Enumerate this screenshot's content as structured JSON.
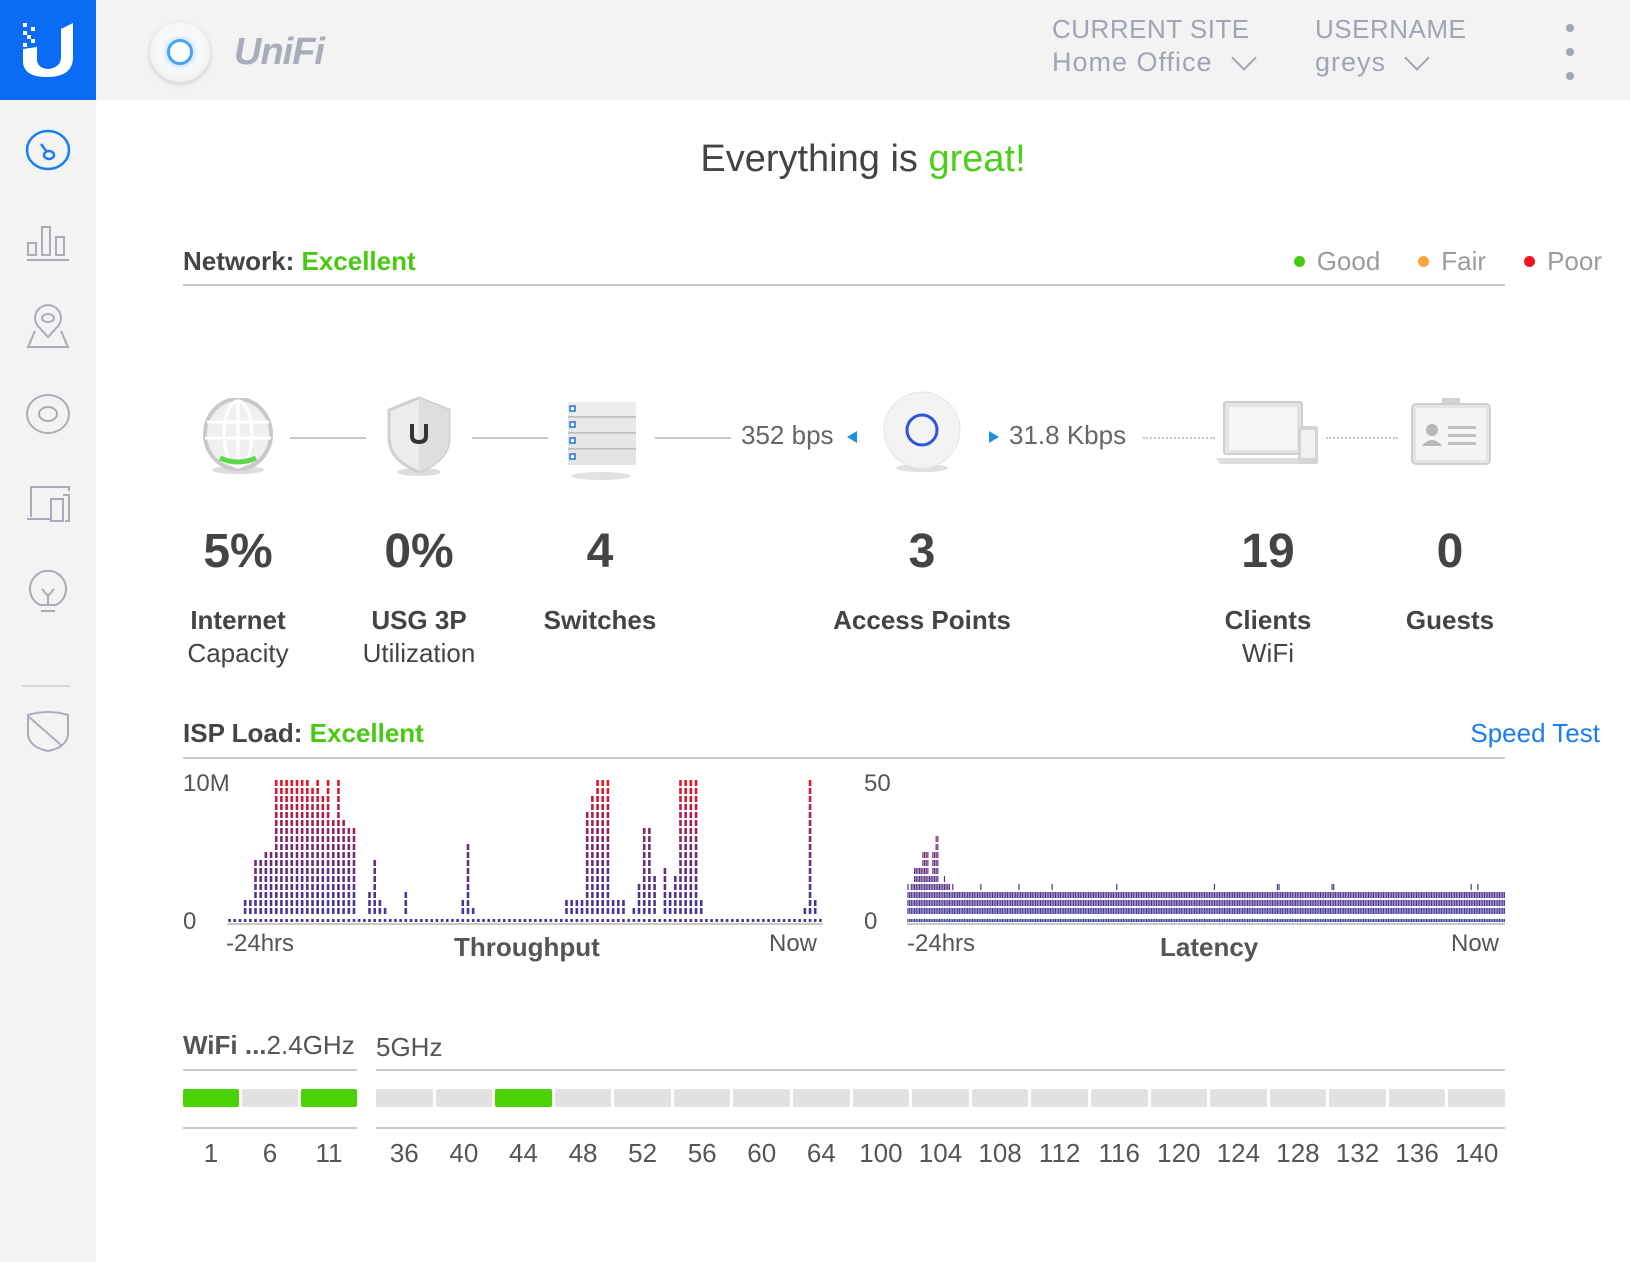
{
  "header": {
    "app_name": "UniFi",
    "site_caption": "CURRENT SITE",
    "site_value": "Home Office",
    "user_caption": "USERNAME",
    "user_value": "greys"
  },
  "sidebar": {
    "items": [
      {
        "name": "dashboard",
        "icon": "dashboard-gauge-icon",
        "active": true
      },
      {
        "name": "statistics",
        "icon": "bar-chart-icon",
        "active": false
      },
      {
        "name": "map",
        "icon": "map-pin-icon",
        "active": false
      },
      {
        "name": "devices",
        "icon": "access-point-icon",
        "active": false
      },
      {
        "name": "clients",
        "icon": "client-devices-icon",
        "active": false
      },
      {
        "name": "insights",
        "icon": "lightbulb-icon",
        "active": false
      },
      {
        "name": "alerts",
        "icon": "shield-slash-icon",
        "active": false
      }
    ]
  },
  "headline": {
    "prefix": "Everything is ",
    "status": "great!"
  },
  "network": {
    "label": "Network:",
    "status": "Excellent",
    "legend": [
      {
        "label": "Good",
        "color": "#44cc11"
      },
      {
        "label": "Fair",
        "color": "#f9a537"
      },
      {
        "label": "Poor",
        "color": "#f0141e"
      }
    ],
    "uplink_rate": "352 bps",
    "downlink_rate": "31.8 Kbps",
    "stats": [
      {
        "value": "5%",
        "line1": "Internet",
        "line2": "Capacity"
      },
      {
        "value": "0%",
        "line1": "USG 3P",
        "line2": "Utilization"
      },
      {
        "value": "4",
        "line1": "Switches",
        "line2": ""
      },
      {
        "value": "3",
        "line1": "Access Points",
        "line2": ""
      },
      {
        "value": "19",
        "line1": "Clients",
        "line2": "WiFi"
      },
      {
        "value": "0",
        "line1": "Guests",
        "line2": ""
      }
    ]
  },
  "isp": {
    "label": "ISP Load:",
    "status": "Excellent",
    "speed_test_label": "Speed Test"
  },
  "chart_data": [
    {
      "type": "bar",
      "title": "Throughput",
      "ylabel": "",
      "ymax_label": "10M",
      "ymin_label": "0",
      "x_start_label": "-24hrs",
      "x_end_label": "Now",
      "ylim": [
        0,
        10
      ],
      "units": "Mbps",
      "values": [
        0.3,
        0.8,
        0.8,
        1.6,
        1.6,
        4.2,
        4.2,
        5.1,
        5.1,
        10,
        10,
        10,
        10,
        10,
        10,
        10,
        9.4,
        10,
        8.9,
        10,
        7.3,
        10,
        7.3,
        6.9,
        6.9,
        0.6,
        0.6,
        2.3,
        4.2,
        1.8,
        1.3,
        0.7,
        0.6,
        0.6,
        2.1,
        0.4,
        0.3,
        0.3,
        0.2,
        0.8,
        0.3,
        0.1,
        0.3,
        0.1,
        0,
        1.8,
        5.3,
        0.9,
        0.2,
        0,
        0,
        0.2,
        0,
        0.2,
        0.1,
        0,
        0,
        0.1,
        0,
        0,
        0,
        0,
        0.2,
        0.6,
        0.8,
        1.4,
        1.4,
        1.4,
        1.6,
        8,
        8.7,
        10,
        10,
        10,
        1.6,
        1.4,
        1.4,
        0.8,
        1.2,
        2.9,
        6.5,
        6.5,
        3.1,
        0.8,
        3.9,
        2.3,
        3.5,
        10,
        10,
        10,
        10,
        1.6,
        0.6,
        0.2,
        0.1,
        0,
        0,
        0,
        0,
        0,
        0,
        0,
        0,
        0.1,
        0,
        0,
        0,
        0,
        0,
        0.2,
        0.3,
        1,
        10,
        1.4,
        0.8
      ]
    },
    {
      "type": "bar",
      "title": "Latency",
      "ylabel": "",
      "ymax_label": "50",
      "ymin_label": "0",
      "x_start_label": "-24hrs",
      "x_end_label": "Now",
      "ylim": [
        0,
        50
      ],
      "units": "ms",
      "values": [
        14,
        12,
        15,
        15,
        20,
        20,
        20,
        20,
        20,
        24,
        24,
        24,
        24,
        16,
        16,
        25,
        25,
        30,
        30,
        14,
        13,
        14,
        16,
        13,
        14,
        14,
        12,
        14,
        12,
        12,
        12,
        12,
        12,
        12,
        12,
        12,
        12,
        12,
        12,
        12,
        12,
        12,
        12,
        12,
        13,
        12,
        12,
        12,
        12,
        12,
        12,
        12,
        12,
        12,
        12,
        12,
        12,
        12,
        12,
        12,
        12,
        12,
        12,
        12,
        12,
        12,
        12,
        13,
        12,
        12,
        12,
        12,
        12,
        12,
        12,
        12,
        12,
        12,
        12,
        12,
        12,
        12,
        12,
        12,
        12,
        12,
        12,
        13,
        12,
        12,
        12,
        12,
        12,
        12,
        12,
        12,
        12,
        12,
        12,
        12,
        12,
        12,
        12,
        12,
        12,
        12,
        12,
        12,
        12,
        12,
        12,
        12,
        12,
        12,
        12,
        12,
        12,
        12,
        12,
        12,
        12,
        12,
        12,
        12,
        12,
        12,
        13,
        12,
        12,
        12,
        12,
        12,
        12,
        12,
        12,
        12,
        12,
        12,
        12,
        12,
        12,
        12,
        12,
        12,
        12,
        12,
        12,
        12,
        12,
        12,
        12,
        12,
        12,
        12,
        12,
        12,
        12,
        12,
        12,
        12,
        12,
        12,
        12,
        12,
        12,
        12,
        12,
        12,
        12,
        12,
        12,
        12,
        12,
        12,
        12,
        12,
        12,
        12,
        12,
        12,
        12,
        12,
        12,
        12,
        12,
        13,
        12,
        12,
        12,
        12,
        12,
        12,
        12,
        12,
        12,
        12,
        12,
        12,
        12,
        12,
        12,
        12,
        12,
        12,
        12,
        12,
        12,
        12,
        12,
        12,
        12,
        12,
        12,
        12,
        12,
        12,
        12,
        12,
        12,
        12,
        12,
        12,
        12,
        13,
        13,
        12,
        12,
        12,
        12,
        12,
        12,
        12,
        12,
        12,
        12,
        12,
        12,
        12,
        12,
        12,
        12,
        12,
        12,
        12,
        12,
        12,
        12,
        12,
        12,
        12,
        12,
        12,
        12,
        12,
        12,
        12,
        15,
        15,
        12,
        12,
        12,
        12,
        12,
        12,
        12,
        12,
        12,
        12,
        12,
        12,
        12,
        12,
        12,
        12,
        12,
        12,
        12,
        12,
        12,
        12,
        12,
        12,
        12,
        12,
        12,
        12,
        12,
        12,
        12,
        12,
        12,
        12,
        12,
        12,
        12,
        12,
        12,
        12,
        12,
        12,
        12,
        12,
        12,
        12,
        12,
        12,
        12,
        12,
        12,
        12,
        12,
        12,
        12,
        12,
        12,
        12,
        12,
        12,
        12,
        12,
        12,
        12,
        12,
        12,
        12,
        12,
        12,
        12,
        12,
        12,
        12,
        12,
        12,
        12,
        12,
        12,
        12,
        12,
        12,
        12,
        13,
        12,
        12,
        12,
        13,
        12,
        12,
        12,
        12,
        12,
        12,
        12,
        12,
        12,
        12,
        12,
        12,
        12,
        12,
        12,
        12
      ]
    }
  ],
  "wifi": {
    "label": "WiFi ...",
    "band_24_label": "2.4GHz",
    "band_5_label": "5GHz",
    "channels_24": [
      {
        "ch": "1",
        "active": true
      },
      {
        "ch": "6",
        "active": false
      },
      {
        "ch": "11",
        "active": true
      }
    ],
    "channels_5": [
      {
        "ch": "36",
        "active": false
      },
      {
        "ch": "40",
        "active": false
      },
      {
        "ch": "44",
        "active": true
      },
      {
        "ch": "48",
        "active": false
      },
      {
        "ch": "52",
        "active": false
      },
      {
        "ch": "56",
        "active": false
      },
      {
        "ch": "60",
        "active": false
      },
      {
        "ch": "64",
        "active": false
      },
      {
        "ch": "100",
        "active": false
      },
      {
        "ch": "104",
        "active": false
      },
      {
        "ch": "108",
        "active": false
      },
      {
        "ch": "112",
        "active": false
      },
      {
        "ch": "116",
        "active": false
      },
      {
        "ch": "120",
        "active": false
      },
      {
        "ch": "124",
        "active": false
      },
      {
        "ch": "128",
        "active": false
      },
      {
        "ch": "132",
        "active": false
      },
      {
        "ch": "136",
        "active": false
      },
      {
        "ch": "140",
        "active": false
      }
    ],
    "active_color": "#4ad300",
    "inactive_color": "#e2e2e2"
  },
  "colors": {
    "brand_blue": "#0a6cf5",
    "status_green": "#48c912",
    "link_blue": "#1a7ef0",
    "chart_low": "#3a3aa0",
    "chart_high": "#f0141e"
  }
}
